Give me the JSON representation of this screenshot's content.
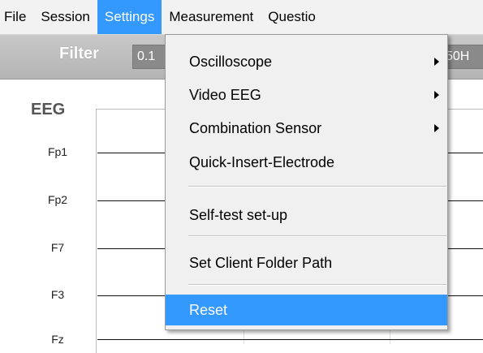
{
  "menubar": {
    "items": [
      {
        "label": "File"
      },
      {
        "label": "Session"
      },
      {
        "label": "Settings"
      },
      {
        "label": "Measurement"
      },
      {
        "label": "Questio"
      }
    ]
  },
  "toolbar": {
    "filter_label": "Filter",
    "filter_low_value": "0.1",
    "filter_high_value": "50H"
  },
  "eeg": {
    "title": "EEG",
    "channels": [
      "Fp1",
      "Fp2",
      "F7",
      "F3",
      "Fz"
    ]
  },
  "settings_menu": {
    "items": [
      {
        "label": "Oscilloscope"
      },
      {
        "label": "Video EEG"
      },
      {
        "label": "Combination Sensor"
      },
      {
        "label": "Quick-Insert-Electrode"
      },
      {
        "label": "Self-test set-up"
      },
      {
        "label": "Set Client Folder Path"
      },
      {
        "label": "Reset"
      }
    ]
  },
  "colors": {
    "highlight": "#3399ff",
    "menu_background": "#f0f0f0",
    "toolbar_background": "#bdbdbd"
  }
}
